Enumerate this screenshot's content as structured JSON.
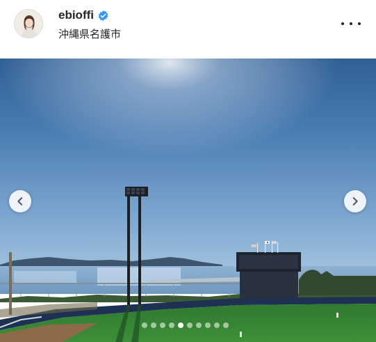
{
  "post": {
    "username": "ebioffi",
    "location": "沖縄県名護市",
    "verified": true
  },
  "icons": {
    "verified": "verified-badge-icon",
    "more": "more-options-icon",
    "prev": "chevron-left-icon",
    "next": "chevron-right-icon"
  },
  "carousel": {
    "total": 10,
    "active_index": 4
  },
  "colors": {
    "verified_blue": "#3897f0",
    "text": "#262626"
  }
}
